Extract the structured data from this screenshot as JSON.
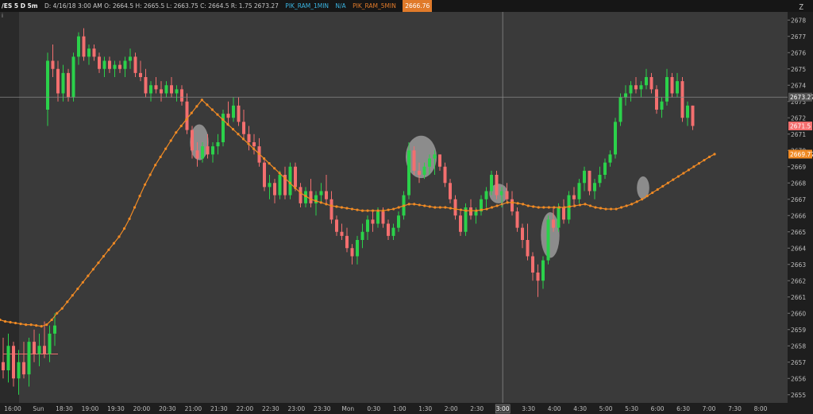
{
  "header": {
    "symbol": "/ES 5 D 5m",
    "ohlc": "D: 4/16/18 3:00 AM  O: 2664.5  H: 2665.5  L: 2663.75  C: 2664.5  R: 1.75  2673.27",
    "study1_label": "PIK_RAM_1MIN",
    "study1_value": "N/A",
    "study2_label": "PIK_RAM_5MIN",
    "study2_value": "2666.76",
    "z_icon": "Z",
    "info_icon": "i"
  },
  "colors": {
    "background": "#3a3a3a",
    "prepost_background": "#2a2a2a",
    "grid": "#303030",
    "up": "#2bd14a",
    "down": "#f36f6f",
    "ma": "#f08a24",
    "crosshair": "#888888",
    "axis_text": "#bdbdbd",
    "highlight": "#cfcfcf"
  },
  "chart_data": {
    "type": "candlestick",
    "ylim": [
      2654.5,
      2678.5
    ],
    "y_ticks": [
      2655,
      2656,
      2657,
      2658,
      2659,
      2660,
      2661,
      2662,
      2663,
      2664,
      2665,
      2666,
      2667,
      2668,
      2669,
      2670,
      2671,
      2672,
      2673,
      2674,
      2675,
      2676,
      2677,
      2678
    ],
    "x_ticks": [
      "16:00",
      "Sun",
      "18:30",
      "19:00",
      "19:30",
      "20:00",
      "20:30",
      "21:00",
      "21:30",
      "22:00",
      "22:30",
      "23:00",
      "23:30",
      "Mon",
      "0:30",
      "1:00",
      "1:30",
      "2:00",
      "2:30",
      "3:00",
      "3:30",
      "4:00",
      "4:30",
      "5:00",
      "5:30",
      "6:00",
      "6:30",
      "7:00",
      "7:30",
      "8:00"
    ],
    "crosshair": {
      "x_label": "3:00",
      "y_value": 2673.27
    },
    "price_labels": [
      {
        "value": 2673.27,
        "label": "2673.27",
        "style": "crosshair"
      },
      {
        "value": 2671.5,
        "label": "2671.5",
        "style": "down"
      },
      {
        "value": 2669.77,
        "label": "2669.77",
        "style": "ma"
      }
    ],
    "candles": [
      [
        2657,
        2658.5,
        2656,
        2656.5
      ],
      [
        2656.5,
        2658.75,
        2655.75,
        2658
      ],
      [
        2658,
        2658.25,
        2655.5,
        2656
      ],
      [
        2656,
        2657.75,
        2655,
        2657
      ],
      [
        2657,
        2658.25,
        2656,
        2656.25
      ],
      [
        2656.25,
        2658.5,
        2655.5,
        2658.25
      ],
      [
        2658.25,
        2659,
        2657,
        2657.5
      ],
      [
        2657.5,
        2658.75,
        2656.75,
        2658
      ],
      [
        2658,
        2659.5,
        2657.25,
        2657.5
      ],
      [
        2657.5,
        2659.25,
        2657,
        2658.75
      ],
      [
        2658.75,
        2660,
        2658,
        2659.25
      ],
      [
        2672.5,
        2676,
        2671.5,
        2675.5
      ],
      [
        2675.5,
        2676.5,
        2674.5,
        2675
      ],
      [
        2675,
        2675.5,
        2673,
        2673.5
      ],
      [
        2673.5,
        2675.25,
        2673,
        2674.75
      ],
      [
        2674.75,
        2675,
        2673,
        2673.25
      ],
      [
        2673.25,
        2676,
        2673,
        2675.75
      ],
      [
        2675.75,
        2677.25,
        2675.25,
        2677
      ],
      [
        2677,
        2677.5,
        2675.5,
        2675.75
      ],
      [
        2675.75,
        2676.5,
        2675.25,
        2676.25
      ],
      [
        2676.25,
        2676.5,
        2675.5,
        2675.75
      ],
      [
        2675.75,
        2676,
        2674.75,
        2675
      ],
      [
        2675,
        2675.75,
        2674.5,
        2675.5
      ],
      [
        2675.5,
        2675.75,
        2674.75,
        2675
      ],
      [
        2675,
        2675.5,
        2674.5,
        2675.25
      ],
      [
        2675.25,
        2675.5,
        2674.75,
        2675
      ],
      [
        2675,
        2675.75,
        2674.5,
        2675.5
      ],
      [
        2675.5,
        2676.25,
        2675,
        2675.75
      ],
      [
        2675.75,
        2676,
        2674.5,
        2674.75
      ],
      [
        2674.75,
        2675.5,
        2674.25,
        2674.5
      ],
      [
        2674.5,
        2675,
        2673.25,
        2673.5
      ],
      [
        2673.5,
        2674.25,
        2673,
        2674
      ],
      [
        2674,
        2674.5,
        2673.5,
        2673.75
      ],
      [
        2673.75,
        2674.25,
        2673,
        2673.5
      ],
      [
        2673.5,
        2674.25,
        2673.25,
        2674
      ],
      [
        2674,
        2674.5,
        2673.25,
        2673.5
      ],
      [
        2673.5,
        2674,
        2673,
        2673.75
      ],
      [
        2673.75,
        2674,
        2672.75,
        2673
      ],
      [
        2673,
        2673.5,
        2671,
        2671.25
      ],
      [
        2671.25,
        2671.5,
        2669.5,
        2670
      ],
      [
        2670,
        2670.5,
        2669,
        2669.5
      ],
      [
        2669.5,
        2670.5,
        2669.25,
        2670.25
      ],
      [
        2670.25,
        2671,
        2669.5,
        2669.75
      ],
      [
        2669.75,
        2670.5,
        2669.25,
        2670.25
      ],
      [
        2670.25,
        2671,
        2669.75,
        2670.5
      ],
      [
        2670.5,
        2672.5,
        2670.25,
        2672.25
      ],
      [
        2672.25,
        2673,
        2671.5,
        2672
      ],
      [
        2672,
        2673.25,
        2671.75,
        2672.75
      ],
      [
        2672.75,
        2673.25,
        2671.5,
        2671.75
      ],
      [
        2671.75,
        2672.5,
        2670.75,
        2671
      ],
      [
        2671,
        2671.5,
        2670,
        2670.5
      ],
      [
        2670.5,
        2671,
        2669.75,
        2670.25
      ],
      [
        2670.25,
        2670.75,
        2669,
        2669.25
      ],
      [
        2669.25,
        2669.5,
        2667.5,
        2667.75
      ],
      [
        2667.75,
        2668.5,
        2667,
        2668
      ],
      [
        2668,
        2668.25,
        2666.75,
        2667.25
      ],
      [
        2667.25,
        2668.75,
        2667,
        2668.5
      ],
      [
        2668.5,
        2669,
        2667,
        2667.25
      ],
      [
        2667.25,
        2669.25,
        2667,
        2669
      ],
      [
        2669,
        2669.25,
        2667.5,
        2667.75
      ],
      [
        2667.75,
        2668,
        2666.5,
        2666.75
      ],
      [
        2666.75,
        2667.75,
        2666.5,
        2667.5
      ],
      [
        2667.5,
        2668.25,
        2666.5,
        2666.75
      ],
      [
        2666.75,
        2667.5,
        2666,
        2667.25
      ],
      [
        2667.25,
        2668,
        2666.75,
        2667.5
      ],
      [
        2667.5,
        2668.5,
        2666.75,
        2667
      ],
      [
        2667,
        2667.5,
        2665.5,
        2665.75
      ],
      [
        2665.75,
        2666,
        2664.75,
        2665
      ],
      [
        2665,
        2665.5,
        2664.5,
        2664.75
      ],
      [
        2664.75,
        2665.25,
        2663.75,
        2664
      ],
      [
        2664,
        2664.25,
        2663,
        2663.5
      ],
      [
        2663.5,
        2664.75,
        2663,
        2664.5
      ],
      [
        2664.5,
        2665.5,
        2664,
        2665
      ],
      [
        2665,
        2666,
        2664.5,
        2665.75
      ],
      [
        2665.75,
        2666.25,
        2665,
        2665.5
      ],
      [
        2665.5,
        2666.5,
        2665.25,
        2666.25
      ],
      [
        2666.25,
        2666.5,
        2665.25,
        2665.5
      ],
      [
        2665.5,
        2665.75,
        2664.5,
        2664.75
      ],
      [
        2664.75,
        2665.5,
        2664.5,
        2665.25
      ],
      [
        2665.25,
        2666.25,
        2665,
        2666
      ],
      [
        2666,
        2667.5,
        2665.75,
        2667.25
      ],
      [
        2667.25,
        2670.5,
        2667,
        2670
      ],
      [
        2670,
        2670.25,
        2668.5,
        2668.75
      ],
      [
        2668.75,
        2669.25,
        2668,
        2668.5
      ],
      [
        2668.5,
        2669.25,
        2668.25,
        2669
      ],
      [
        2669,
        2669.75,
        2668.5,
        2669.5
      ],
      [
        2669.5,
        2670,
        2668.5,
        2669.75
      ],
      [
        2669.75,
        2669.75,
        2668.75,
        2669
      ],
      [
        2669,
        2669.25,
        2667.75,
        2668
      ],
      [
        2668,
        2668.25,
        2666.75,
        2667
      ],
      [
        2667,
        2667.25,
        2665.75,
        2666
      ],
      [
        2666,
        2666.25,
        2664.75,
        2665
      ],
      [
        2665,
        2666.75,
        2664.75,
        2666.5
      ],
      [
        2666.5,
        2667,
        2665.75,
        2666
      ],
      [
        2666,
        2666.5,
        2665.5,
        2666.25
      ],
      [
        2666.25,
        2667.25,
        2666,
        2667
      ],
      [
        2667,
        2667.75,
        2666.5,
        2667.5
      ],
      [
        2667.5,
        2668.75,
        2667.25,
        2668.5
      ],
      [
        2668.5,
        2668.75,
        2667,
        2667.25
      ],
      [
        2667.25,
        2667.75,
        2666.5,
        2667.5
      ],
      [
        2667.5,
        2668,
        2666.75,
        2667
      ],
      [
        2667,
        2667.5,
        2666,
        2666.25
      ],
      [
        2666.25,
        2666.5,
        2665,
        2665.25
      ],
      [
        2665.25,
        2665.5,
        2664,
        2664.5
      ],
      [
        2664.5,
        2665.5,
        2663.25,
        2663.5
      ],
      [
        2663.5,
        2663.75,
        2662,
        2662.5
      ],
      [
        2662.5,
        2663,
        2661,
        2662
      ],
      [
        2662,
        2663.5,
        2661.5,
        2663.25
      ],
      [
        2663.25,
        2666,
        2663,
        2665.75
      ],
      [
        2665.75,
        2666.5,
        2665,
        2665.25
      ],
      [
        2665.25,
        2666.75,
        2665,
        2666.5
      ],
      [
        2666.5,
        2667,
        2665.5,
        2665.75
      ],
      [
        2665.75,
        2667.5,
        2665.5,
        2667.25
      ],
      [
        2667.25,
        2667.75,
        2666.5,
        2667
      ],
      [
        2667,
        2668.25,
        2666.75,
        2668
      ],
      [
        2668,
        2669,
        2667.5,
        2668.75
      ],
      [
        2668.75,
        2668.75,
        2667.25,
        2667.5
      ],
      [
        2667.5,
        2668.25,
        2667,
        2668
      ],
      [
        2668,
        2669,
        2667.75,
        2668.5
      ],
      [
        2668.5,
        2669.5,
        2668.25,
        2669.25
      ],
      [
        2669.25,
        2670,
        2669,
        2669.75
      ],
      [
        2669.75,
        2672,
        2669.5,
        2671.75
      ],
      [
        2671.75,
        2673.5,
        2671.5,
        2673.25
      ],
      [
        2673.25,
        2674,
        2672.75,
        2673.5
      ],
      [
        2673.5,
        2674.25,
        2673,
        2674
      ],
      [
        2674,
        2674.5,
        2673.5,
        2673.75
      ],
      [
        2673.75,
        2674.25,
        2673.25,
        2674
      ],
      [
        2674,
        2675,
        2673.75,
        2674.5
      ],
      [
        2674.5,
        2674.75,
        2673.5,
        2673.75
      ],
      [
        2673.75,
        2674,
        2672.25,
        2672.5
      ],
      [
        2672.5,
        2673.25,
        2672,
        2673
      ],
      [
        2673,
        2675,
        2672.75,
        2674.5
      ],
      [
        2674.5,
        2674.75,
        2673.25,
        2673.5
      ],
      [
        2673.5,
        2674.75,
        2673.25,
        2674.25
      ],
      [
        2674.25,
        2674.5,
        2671.75,
        2672
      ],
      [
        2672,
        2673,
        2671.5,
        2672.75
      ],
      [
        2672.75,
        2672.75,
        2671.25,
        2671.5
      ]
    ],
    "ma_points": [
      2659.6,
      2659.5,
      2659.45,
      2659.4,
      2659.35,
      2659.3,
      2659.3,
      2659.25,
      2659.2,
      2659.3,
      2659.6,
      2660,
      2660.3,
      2660.7,
      2661.1,
      2661.5,
      2661.9,
      2662.3,
      2662.7,
      2663.1,
      2663.5,
      2663.9,
      2664.3,
      2664.7,
      2665.2,
      2665.8,
      2666.5,
      2667.2,
      2667.9,
      2668.5,
      2669.1,
      2669.6,
      2670.1,
      2670.6,
      2671.1,
      2671.5,
      2671.9,
      2672.3,
      2672.7,
      2673.1,
      2672.8,
      2672.5,
      2672.2,
      2671.9,
      2671.6,
      2671.3,
      2671,
      2670.7,
      2670.4,
      2670.1,
      2669.8,
      2669.5,
      2669.2,
      2668.9,
      2668.6,
      2668.3,
      2668,
      2667.7,
      2667.4,
      2667.2,
      2667,
      2666.9,
      2666.8,
      2666.7,
      2666.6,
      2666.55,
      2666.5,
      2666.45,
      2666.4,
      2666.35,
      2666.3,
      2666.3,
      2666.3,
      2666.3,
      2666.3,
      2666.35,
      2666.4,
      2666.5,
      2666.6,
      2666.7,
      2666.7,
      2666.65,
      2666.6,
      2666.55,
      2666.5,
      2666.5,
      2666.5,
      2666.45,
      2666.4,
      2666.35,
      2666.3,
      2666.3,
      2666.3,
      2666.35,
      2666.4,
      2666.5,
      2666.6,
      2666.7,
      2666.8,
      2666.8,
      2666.75,
      2666.7,
      2666.6,
      2666.55,
      2666.5,
      2666.5,
      2666.5,
      2666.5,
      2666.5,
      2666.5,
      2666.55,
      2666.6,
      2666.65,
      2666.7,
      2666.6,
      2666.5,
      2666.45,
      2666.4,
      2666.4,
      2666.4,
      2666.5,
      2666.6,
      2666.7,
      2666.85,
      2667,
      2667.2,
      2667.4,
      2667.6,
      2667.8,
      2668,
      2668.2,
      2668.4,
      2668.6,
      2668.8,
      2669,
      2669.2,
      2669.4,
      2669.6,
      2669.77
    ],
    "highlights": [
      {
        "candle": 38,
        "price": 2670.5,
        "rx": 1.8,
        "ry": 1.1
      },
      {
        "candle": 81,
        "price": 2669.6,
        "rx": 3,
        "ry": 1.3
      },
      {
        "candle": 96,
        "price": 2667.35,
        "rx": 1.8,
        "ry": 0.6
      },
      {
        "candle": 106,
        "price": 2664.8,
        "rx": 1.8,
        "ry": 1.4
      },
      {
        "candle": 124,
        "price": 2667.7,
        "rx": 1.2,
        "ry": 0.7
      }
    ],
    "anchor_line": {
      "candle_from": 0,
      "candle_to": 10,
      "price": 2657.5
    }
  }
}
